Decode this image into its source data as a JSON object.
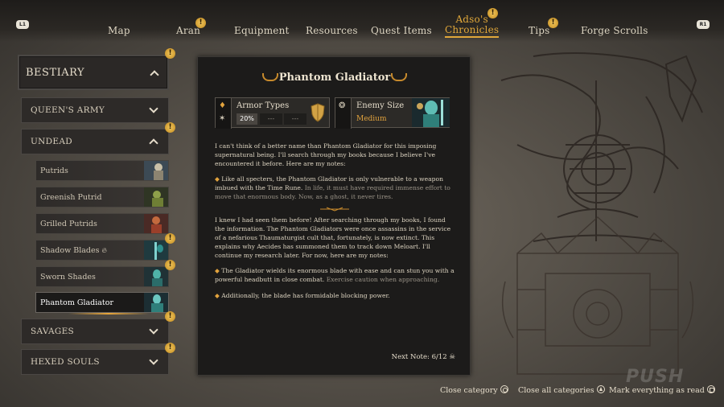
{
  "nav": {
    "left_bumper": "L1",
    "right_bumper": "R1",
    "tabs": [
      {
        "label": "Map"
      },
      {
        "label": "Aran"
      },
      {
        "label": "Equipment"
      },
      {
        "label": "Resources"
      },
      {
        "label": "Quest Items"
      },
      {
        "label": "Adso's",
        "label2": "Chronicles"
      },
      {
        "label": "Tips"
      },
      {
        "label": "Forge Scrolls"
      }
    ]
  },
  "sidebar": {
    "title": "BESTIARY",
    "categories": {
      "queens_army": "QUEEN'S ARMY",
      "undead": "UNDEAD",
      "savages": "SAVAGES",
      "hexed_souls": "HEXED SOULS"
    },
    "undead_items": [
      {
        "label": "Putrids"
      },
      {
        "label": "Greenish Putrid"
      },
      {
        "label": "Grilled Putrids"
      },
      {
        "label": "Shadow Blades"
      },
      {
        "label": "Sworn Shades"
      },
      {
        "label": "Phantom Gladiator"
      }
    ]
  },
  "entry": {
    "title": "Phantom Gladiator",
    "armor": {
      "title": "Armor Types",
      "values": [
        "20%",
        "---",
        "---"
      ]
    },
    "enemy_size": {
      "title": "Enemy Size",
      "value": "Medium"
    },
    "intro": "I can't think of a better name than Phantom Gladiator for this imposing supernatural being. I'll search through my books because I believe I've encountered it before. Here are my notes:",
    "note1_main": "Like all specters, the Phantom Gladiator is only vulnerable to a weapon imbued with the Time Rune.",
    "note1_dim": "In life, it must have required immense effort to move that enormous body. Now, as a ghost, it never tires.",
    "middle": "I knew I had seen them before! After searching through my books, I found the information. The Phantom Gladiators were once assassins in the service of a nefarious Thaumaturgist cult that, fortunately, is now extinct. This explains why Aecides has summoned them to track down Meloart. I'll continue my research later. For now, here are my notes:",
    "note2_main": "The Gladiator wields its enormous blade with ease and can stun you with a powerful headbutt in close combat.",
    "note2_dim": "Exercise caution when approaching.",
    "note3": "Additionally, the blade has formidable blocking power.",
    "next_note": "Next Note: 6/12"
  },
  "footer": {
    "close_category": "Close category",
    "close_all": "Close all categories",
    "mark_read": "Mark everything as read"
  },
  "watermark": "PUSH",
  "colors": {
    "accent": "#e0a73a",
    "alert": "#d9a236"
  }
}
